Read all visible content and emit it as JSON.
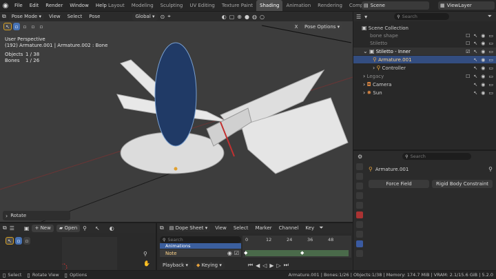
{
  "menu": [
    "File",
    "Edit",
    "Render",
    "Window",
    "Help"
  ],
  "workspaces": [
    "Layout",
    "Modeling",
    "Sculpting",
    "UV Editing",
    "Texture Paint",
    "Shading",
    "Animation",
    "Rendering",
    "Compo"
  ],
  "active_workspace": "Shading",
  "scene": "Scene",
  "view_layer": "ViewLayer",
  "viewport": {
    "mode": "Pose Mode",
    "menu": [
      "View",
      "Select",
      "Pose"
    ],
    "orientation": "Global",
    "pose_options": "Pose Options",
    "x_label": "X",
    "info": [
      "User Perspective",
      "(192) Armature.001 | Armature.002 : Bone"
    ],
    "objects_label": "Objects",
    "objects_value": "1 / 38",
    "bones_label": "Bones",
    "bones_value": "1 / 26",
    "operator": "Rotate"
  },
  "outliner": {
    "search_placeholder": "Search",
    "collection": "Scene Collection",
    "items": [
      "bone shape",
      "Stiletto",
      "Stiletto - Inner",
      "Armature.001",
      "Controller",
      "Legacy",
      "Camera",
      "Sun"
    ]
  },
  "properties": {
    "search_placeholder": "Search",
    "object": "Armature.001",
    "buttons": [
      "Force Field",
      "Rigid Body Constraint"
    ]
  },
  "bottom_left": {
    "new": "New",
    "open": "Open"
  },
  "dopesheet": {
    "mode": "Dope Sheet",
    "menu": [
      "View",
      "Select",
      "Marker",
      "Channel",
      "Key"
    ],
    "search_placeholder": "Search",
    "channels": [
      "Animations",
      "Note"
    ],
    "frames": [
      "0",
      "12",
      "24",
      "36",
      "48"
    ],
    "playback": "Playback",
    "keying": "Keying"
  },
  "status": {
    "left": [
      "Select",
      "Rotate View",
      "Options"
    ],
    "right": "Armature.001 | Bones:1/26 | Objects:1/38 | Memory: 174.7 MiB | VRAM: 2.1/15.6 GiB | 5.2.0"
  },
  "colors": {
    "accent": "#4772b3",
    "selection": "#334d80",
    "viewport": "#3d3d3d"
  }
}
